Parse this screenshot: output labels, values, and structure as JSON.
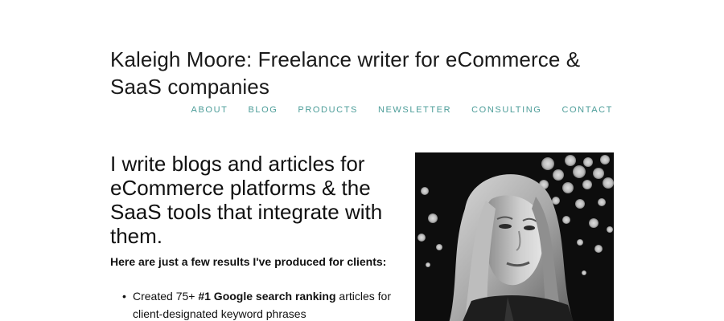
{
  "header": {
    "site_title": "Kaleigh Moore: Freelance writer for eCommerce & SaaS companies",
    "nav": [
      {
        "label": "ABOUT"
      },
      {
        "label": "BLOG"
      },
      {
        "label": "PRODUCTS"
      },
      {
        "label": "NEWSLETTER"
      },
      {
        "label": "CONSULTING"
      },
      {
        "label": "CONTACT"
      }
    ],
    "nav_color": "#4e9e9a"
  },
  "main": {
    "headline": "I write blogs and articles for eCommerce platforms & the SaaS tools that integrate with them.",
    "subhead": "Here are just a few results I've produced for clients:",
    "results": [
      {
        "prefix": "Created 75+ ",
        "bold": "#1 Google search ranking",
        "suffix": " articles for client-designated keyword phrases"
      }
    ],
    "bullet": "•"
  },
  "portrait": {
    "icon": "portrait-photo",
    "style": "black-and-white"
  }
}
